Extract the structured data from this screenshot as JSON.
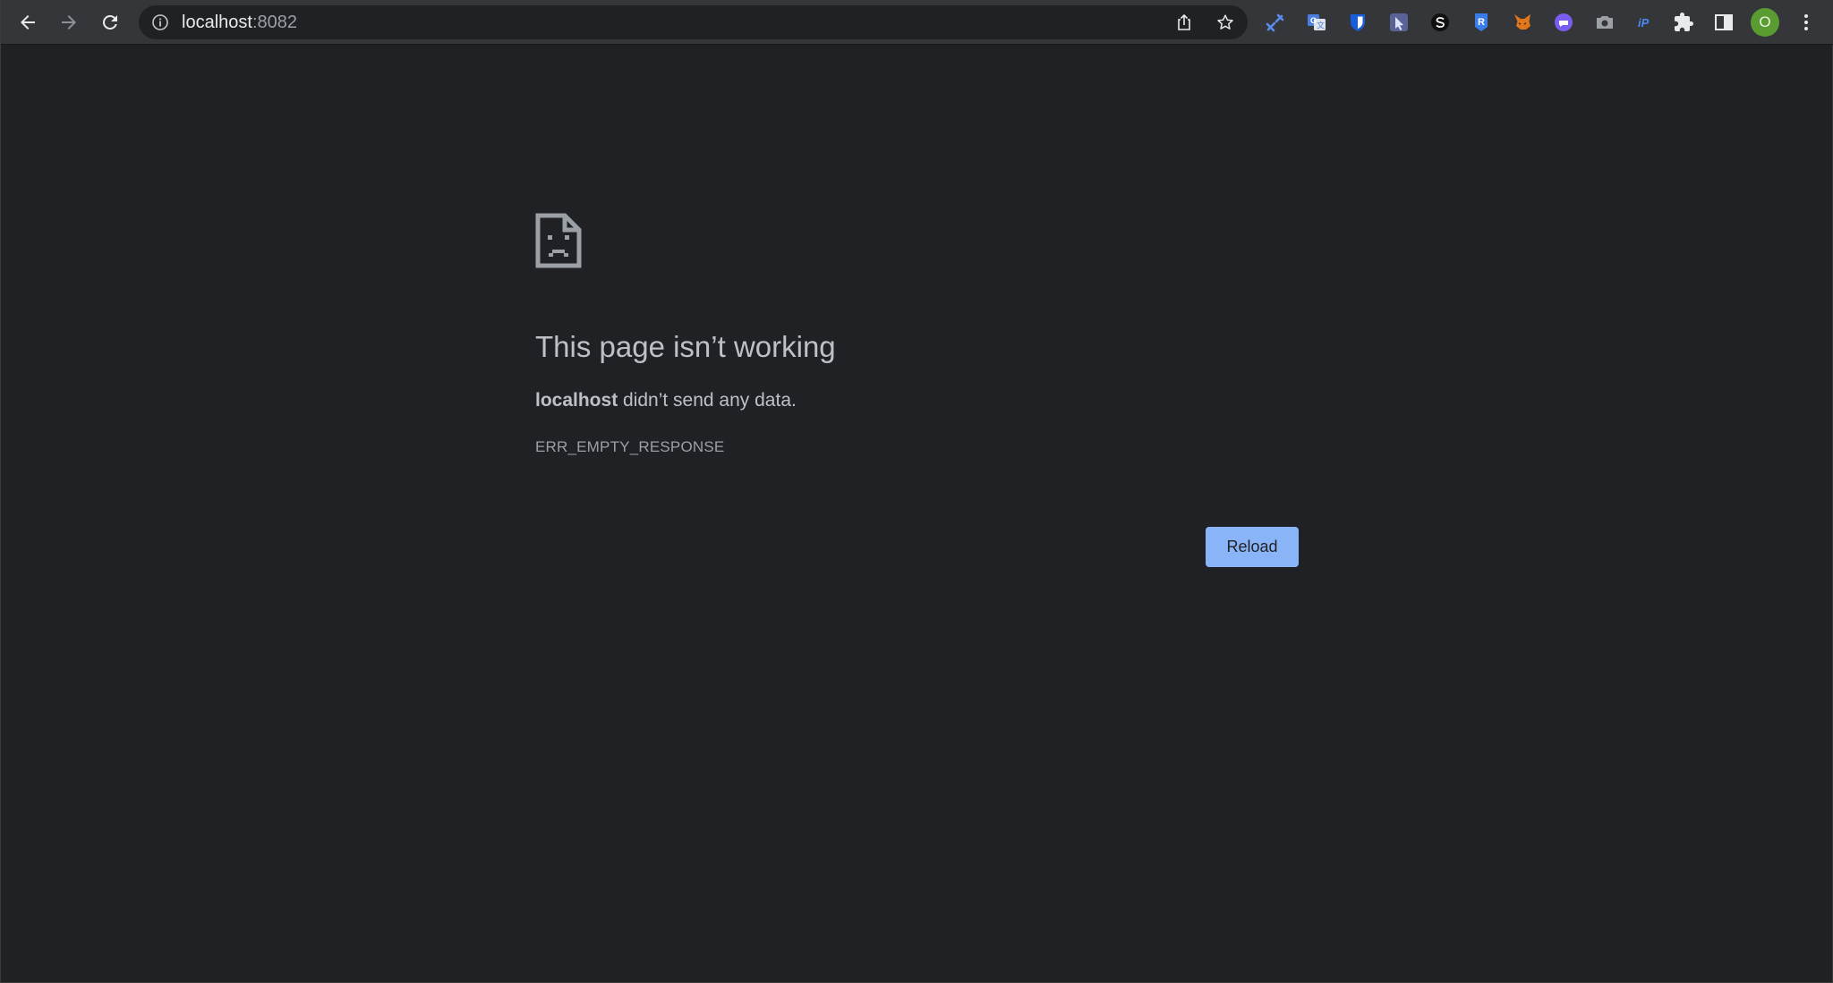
{
  "toolbar": {
    "url_host": "localhost",
    "url_port": ":8082",
    "extensions": [
      {
        "name": "tools-extension-icon",
        "color": "#5b8def"
      },
      {
        "name": "google-translate-icon",
        "color": "#4a7fe0"
      },
      {
        "name": "bitwarden-icon",
        "color": "#175ddc"
      },
      {
        "name": "cursor-extension-icon",
        "color": "#7b8bd9"
      },
      {
        "name": "s-extension-icon",
        "color": "#ffffff"
      },
      {
        "name": "r-extension-icon",
        "color": "#3b7de8"
      },
      {
        "name": "metamask-icon",
        "color": "#e2761b"
      },
      {
        "name": "chat-extension-icon",
        "color": "#7a5cf0"
      },
      {
        "name": "camera-extension-icon",
        "color": "#9aa0a6"
      },
      {
        "name": "ip-extension-icon",
        "color": "#4a8af4"
      },
      {
        "name": "puzzle-extensions-icon",
        "color": "#e8eaed"
      },
      {
        "name": "side-panel-icon",
        "color": "#e8eaed"
      }
    ],
    "avatar_letter": "O",
    "avatar_color": "#5a9b32"
  },
  "error": {
    "icon": "sad-page-icon",
    "title": "This page isn’t working",
    "host": "localhost",
    "desc_suffix": " didn’t send any data.",
    "code": "ERR_EMPTY_RESPONSE",
    "reload_label": "Reload"
  },
  "colors": {
    "background": "#202124",
    "toolbar": "#35363a",
    "accent": "#8ab4f8",
    "text": "#bdc1c6"
  }
}
